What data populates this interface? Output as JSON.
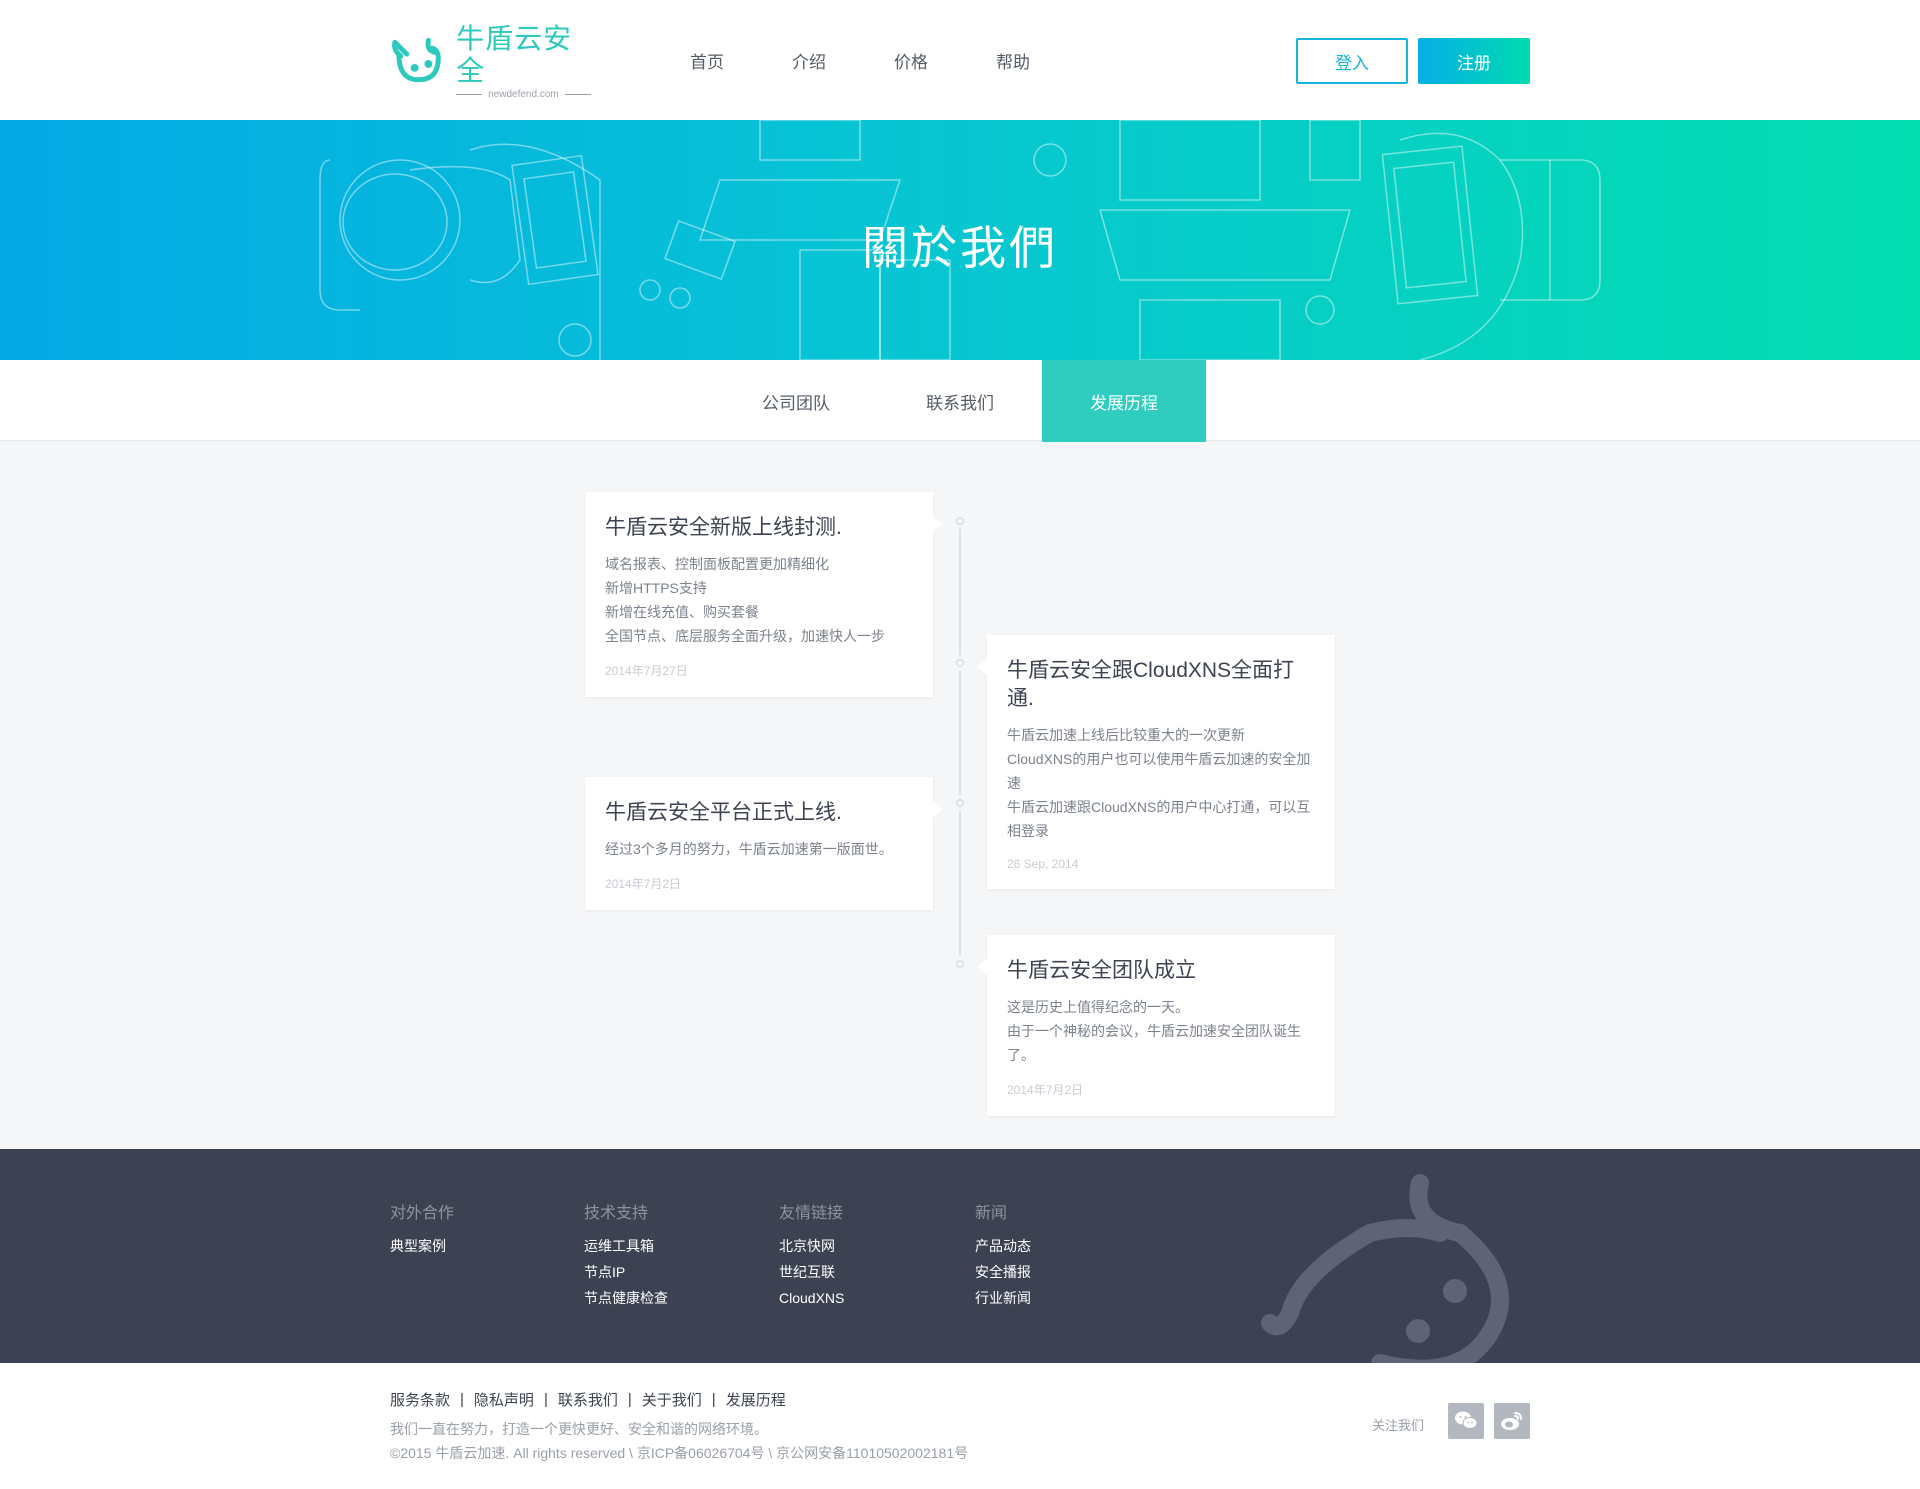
{
  "header": {
    "logo_cn": "牛盾云安全",
    "logo_en": "newdefend.com",
    "nav": [
      "首页",
      "介绍",
      "价格",
      "帮助"
    ],
    "login_label": "登入",
    "register_label": "注册"
  },
  "banner": {
    "title": "關於我們"
  },
  "subtabs": [
    "公司团队",
    "联系我们",
    "发展历程"
  ],
  "timeline": [
    {
      "title": "牛盾云安全新版上线封测.",
      "lines": [
        "域名报表、控制面板配置更加精细化",
        "新增HTTPS支持",
        "新增在线充值、购买套餐",
        "全国节点、底层服务全面升级，加速快人一步"
      ],
      "date": "2014年7月27日"
    },
    {
      "title": "牛盾云安全跟CloudXNS全面打通.",
      "lines": [
        "牛盾云加速上线后比较重大的一次更新",
        "CloudXNS的用户也可以使用牛盾云加速的安全加速",
        "牛盾云加速跟CloudXNS的用户中心打通，可以互相登录"
      ],
      "date": "26 Sep, 2014"
    },
    {
      "title": "牛盾云安全平台正式上线.",
      "lines": [
        "经过3个多月的努力，牛盾云加速第一版面世。"
      ],
      "date": "2014年7月2日"
    },
    {
      "title": "牛盾云安全团队成立",
      "lines": [
        "这是历史上值得纪念的一天。",
        "由于一个神秘的会议，牛盾云加速安全团队诞生了。"
      ],
      "date": "2014年7月2日"
    }
  ],
  "footer": {
    "columns": [
      {
        "heading": "对外合作",
        "items": [
          "典型案例"
        ]
      },
      {
        "heading": "技术支持",
        "items": [
          "运维工具箱",
          "节点IP",
          "节点健康检查"
        ]
      },
      {
        "heading": "友情链接",
        "items": [
          "北京快网",
          "世纪互联",
          "CloudXNS"
        ]
      },
      {
        "heading": "新闻",
        "items": [
          "产品动态",
          "安全播报",
          "行业新闻"
        ]
      }
    ]
  },
  "bottom": {
    "links": [
      "服务条款",
      "隐私声明",
      "联系我们",
      "关于我们",
      "发展历程"
    ],
    "separator": "|",
    "slogan": "我们一直在努力，打造一个更快更好、安全和谐的网络环境。",
    "copyright": "©2015 牛盾云加速. All rights reserved \\ 京ICP备06026704号 \\ 京公网安备11010502002181号",
    "follow_label": "关注我们",
    "social_icons": [
      "wechat-icon",
      "weibo-icon"
    ]
  },
  "colors": {
    "brand": "#2ecdbf",
    "accent_blue": "#16b4d8",
    "footer_bg": "#3c4252"
  }
}
